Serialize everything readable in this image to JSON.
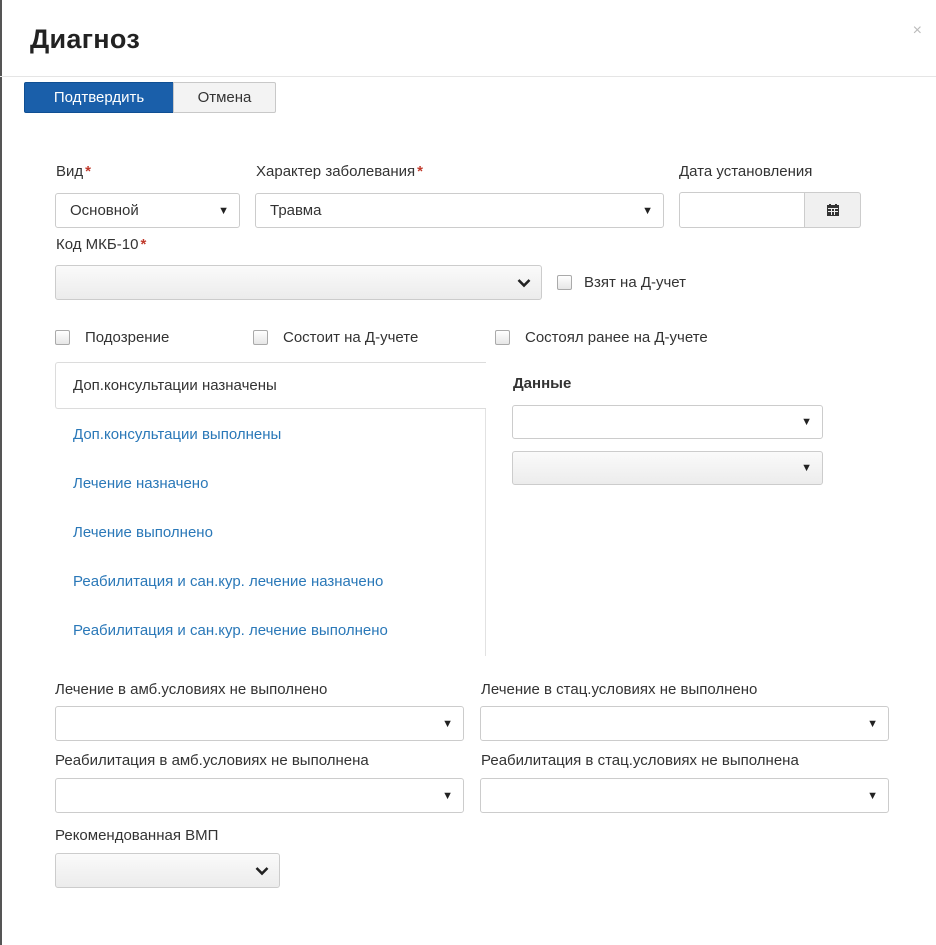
{
  "dialog": {
    "title": "Диагноз",
    "close_glyph": "×"
  },
  "toolbar": {
    "confirm_label": "Подтвердить",
    "cancel_label": "Отмена"
  },
  "form": {
    "vid": {
      "label": "Вид",
      "required_mark": "*",
      "value": "Основной"
    },
    "character": {
      "label": "Характер заболевания",
      "required_mark": "*",
      "value": "Травма"
    },
    "date": {
      "label": "Дата установления",
      "value": "",
      "icon": "calendar-icon"
    },
    "mkb": {
      "label": "Код МКБ-10",
      "required_mark": "*",
      "value": ""
    },
    "d_uchet_taken": {
      "label": "Взят на Д-учет",
      "checked": false
    },
    "suspicion": {
      "label": "Подозрение",
      "checked": false
    },
    "on_d_uchet": {
      "label": "Состоит на Д-учете",
      "checked": false
    },
    "was_on_d_uchet": {
      "label": "Состоял ранее на Д-учете",
      "checked": false
    }
  },
  "tabs": [
    {
      "label": "Доп.консультации назначены",
      "active": true
    },
    {
      "label": "Доп.консультации выполнены",
      "active": false
    },
    {
      "label": "Лечение назначено",
      "active": false
    },
    {
      "label": "Лечение выполнено",
      "active": false
    },
    {
      "label": "Реабилитация и сан.кур. лечение назначено",
      "active": false
    },
    {
      "label": "Реабилитация и сан.кур. лечение выполнено",
      "active": false
    }
  ],
  "data_panel": {
    "heading": "Данные",
    "select1_value": "",
    "select2_value": ""
  },
  "bottom": {
    "amb_treatment": {
      "label": "Лечение в амб.условиях не выполнено",
      "value": ""
    },
    "stat_treatment": {
      "label": "Лечение в стац.условиях не выполнено",
      "value": ""
    },
    "amb_rehab": {
      "label": "Реабилитация в амб.условиях не выполнена",
      "value": ""
    },
    "stat_rehab": {
      "label": "Реабилитация в стац.условиях не выполнена",
      "value": ""
    },
    "vmp": {
      "label": "Рекомендованная ВМП",
      "value": ""
    }
  },
  "colors": {
    "primary": "#1a5faa",
    "link": "#2a78b8",
    "required": "#c0392b"
  }
}
